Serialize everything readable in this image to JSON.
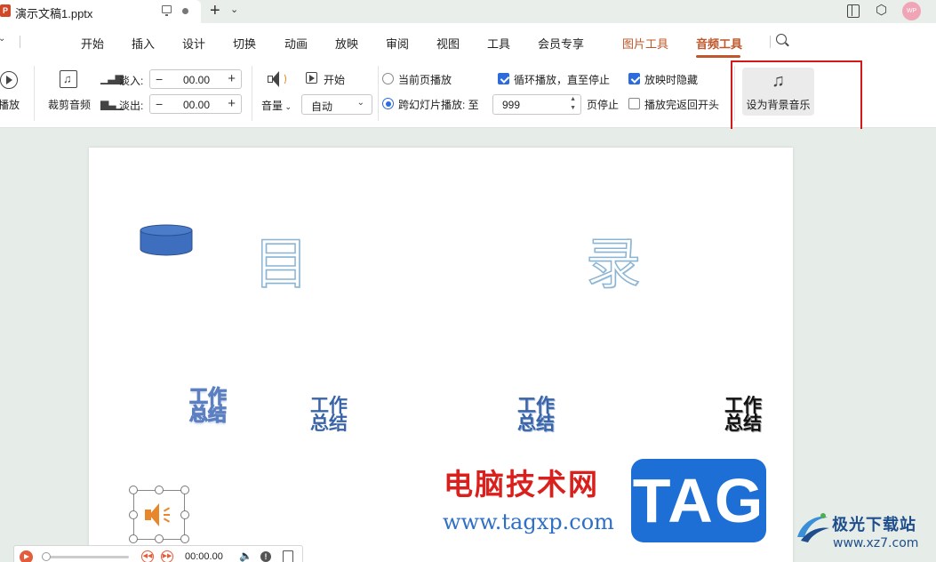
{
  "titlebar": {
    "doc_name": "演示文稿1.pptx",
    "logo_letter": "P",
    "avatar_text": "WP"
  },
  "menu": {
    "items": [
      "开始",
      "插入",
      "设计",
      "切换",
      "动画",
      "放映",
      "审阅",
      "视图",
      "工具",
      "会员专享",
      "图片工具",
      "音频工具"
    ],
    "context_tabs": [
      "图片工具",
      "音频工具"
    ],
    "active": "音频工具"
  },
  "ribbon": {
    "play_label": "播放",
    "trim_label": "裁剪音频",
    "fade_in_label": "淡入:",
    "fade_in_value": "00.00",
    "fade_out_label": "淡出:",
    "fade_out_value": "00.00",
    "volume_label": "音量",
    "start_label": "开始",
    "start_select": "自动",
    "radio_current_page": "当前页播放",
    "radio_across_slides": "跨幻灯片播放: 至",
    "page_stop_value": "999",
    "page_stop_label": "页停止",
    "loop_label": "循环播放，直至停止",
    "hide_label": "放映时隐藏",
    "rewind_label": "播放完返回开头",
    "bg_music_label": "设为背景音乐",
    "states": {
      "radio_current_page": false,
      "radio_across_slides": true,
      "loop": true,
      "hide": true,
      "rewind": false
    }
  },
  "slide": {
    "title_left": "目",
    "title_right": "录",
    "word_art": [
      {
        "line1": "工作",
        "line2": "总结"
      },
      {
        "line1": "工作",
        "line2": "总结"
      },
      {
        "line1": "工作",
        "line2": "总结"
      },
      {
        "line1": "工作",
        "line2": "总结"
      }
    ]
  },
  "player": {
    "time": "00:00.00"
  },
  "watermarks": {
    "cn_text": "电脑技术网",
    "url": "www.tagxp.com",
    "tag": "TAG",
    "jg_name": "极光下载站",
    "jg_url": "www.xz7.com"
  },
  "colors": {
    "accent": "#c0562a",
    "checkbox_blue": "#2c6bdc",
    "highlight_red": "#d51919",
    "tag_blue": "#1d6fd6",
    "cylinder_blue": "#3e6fbe",
    "speaker_orange": "#e8862c"
  },
  "icons": [
    "tab-monitor-icon",
    "tab-dot-icon",
    "plus-icon",
    "chevron-down-icon",
    "split-window-icon",
    "cube-icon",
    "search-icon",
    "play-icon",
    "trim-audio-icon",
    "fade-in-icon",
    "fade-out-icon",
    "volume-icon",
    "start-icon",
    "music-note-icon",
    "speaker-icon",
    "rewind-icon",
    "forward-icon",
    "info-icon",
    "delete-icon"
  ]
}
